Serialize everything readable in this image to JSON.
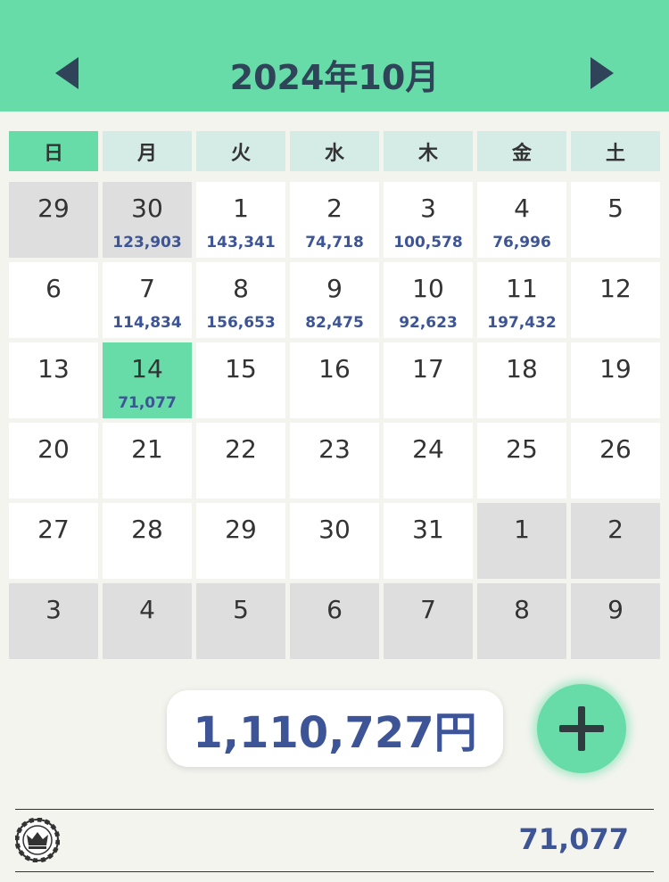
{
  "header": {
    "title": "2024年10月",
    "prev_icon": "triangle-left-icon",
    "next_icon": "triangle-right-icon"
  },
  "weekdays": [
    "日",
    "月",
    "火",
    "水",
    "木",
    "金",
    "土"
  ],
  "weeks": [
    [
      {
        "day": "29",
        "amount": "",
        "other": true
      },
      {
        "day": "30",
        "amount": "123,903",
        "other": true
      },
      {
        "day": "1",
        "amount": "143,341"
      },
      {
        "day": "2",
        "amount": "74,718"
      },
      {
        "day": "3",
        "amount": "100,578"
      },
      {
        "day": "4",
        "amount": "76,996"
      },
      {
        "day": "5",
        "amount": ""
      }
    ],
    [
      {
        "day": "6",
        "amount": ""
      },
      {
        "day": "7",
        "amount": "114,834"
      },
      {
        "day": "8",
        "amount": "156,653"
      },
      {
        "day": "9",
        "amount": "82,475"
      },
      {
        "day": "10",
        "amount": "92,623"
      },
      {
        "day": "11",
        "amount": "197,432"
      },
      {
        "day": "12",
        "amount": ""
      }
    ],
    [
      {
        "day": "13",
        "amount": ""
      },
      {
        "day": "14",
        "amount": "71,077",
        "today": true
      },
      {
        "day": "15",
        "amount": ""
      },
      {
        "day": "16",
        "amount": ""
      },
      {
        "day": "17",
        "amount": ""
      },
      {
        "day": "18",
        "amount": ""
      },
      {
        "day": "19",
        "amount": ""
      }
    ],
    [
      {
        "day": "20",
        "amount": ""
      },
      {
        "day": "21",
        "amount": ""
      },
      {
        "day": "22",
        "amount": ""
      },
      {
        "day": "23",
        "amount": ""
      },
      {
        "day": "24",
        "amount": ""
      },
      {
        "day": "25",
        "amount": ""
      },
      {
        "day": "26",
        "amount": ""
      }
    ],
    [
      {
        "day": "27",
        "amount": ""
      },
      {
        "day": "28",
        "amount": ""
      },
      {
        "day": "29",
        "amount": ""
      },
      {
        "day": "30",
        "amount": ""
      },
      {
        "day": "31",
        "amount": ""
      },
      {
        "day": "1",
        "amount": "",
        "other": true
      },
      {
        "day": "2",
        "amount": "",
        "other": true
      }
    ],
    [
      {
        "day": "3",
        "amount": "",
        "other": true
      },
      {
        "day": "4",
        "amount": "",
        "other": true
      },
      {
        "day": "5",
        "amount": "",
        "other": true
      },
      {
        "day": "6",
        "amount": "",
        "other": true
      },
      {
        "day": "7",
        "amount": "",
        "other": true
      },
      {
        "day": "8",
        "amount": "",
        "other": true
      },
      {
        "day": "9",
        "amount": "",
        "other": true
      }
    ]
  ],
  "summary": {
    "total": "1,110,727円",
    "add_icon": "plus-icon"
  },
  "list": {
    "item_icon": "crown-chip-icon",
    "item_value": "71,077"
  },
  "colors": {
    "accent": "#67dca8",
    "header_text": "#2f4458",
    "amount_text": "#3d5496",
    "weekday_bg": "#d4ebe6",
    "other_month_bg": "#dedede"
  }
}
